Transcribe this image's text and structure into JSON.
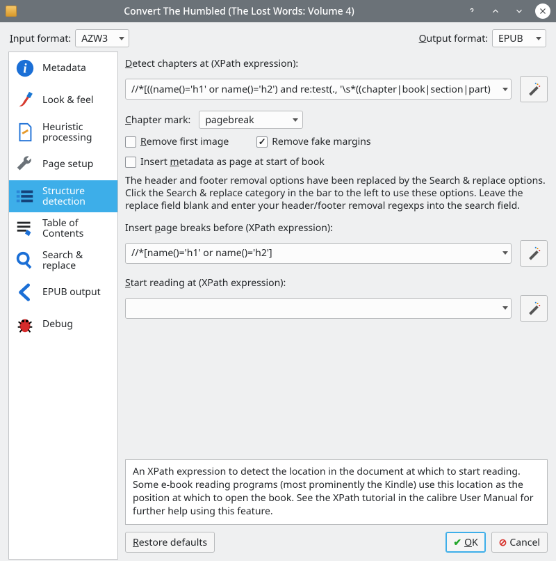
{
  "window": {
    "title": "Convert The Humbled (The Lost Words: Volume 4)"
  },
  "format": {
    "input_label_pre": "I",
    "input_label_rest": "nput format:",
    "input_value": "AZW3",
    "output_label_pre": "O",
    "output_label_rest": "utput format:",
    "output_value": "EPUB"
  },
  "sidebar": {
    "items": [
      {
        "id": "metadata",
        "label": "Metadata"
      },
      {
        "id": "look",
        "label": "Look & feel"
      },
      {
        "id": "heuristic",
        "label": "Heuristic processing"
      },
      {
        "id": "pagesetup",
        "label": "Page setup"
      },
      {
        "id": "structure",
        "label": "Structure detection"
      },
      {
        "id": "toc",
        "label": "Table of Contents"
      },
      {
        "id": "search",
        "label": "Search & replace"
      },
      {
        "id": "epub",
        "label": "EPUB output"
      },
      {
        "id": "debug",
        "label": "Debug"
      }
    ],
    "selected": "structure"
  },
  "detect": {
    "label_pre": "D",
    "label_rest": "etect chapters at (XPath expression):",
    "value": "//*[((name()='h1' or name()='h2') and re:test(., '\\s*((chapter|book|section|part)"
  },
  "chapter_mark": {
    "label_pre": "C",
    "label_rest": "hapter mark:",
    "value": "pagebreak"
  },
  "checks": {
    "remove_first_pre": "R",
    "remove_first_rest": "emove first image",
    "remove_first_checked": false,
    "remove_fake": "Remove fake margins",
    "remove_fake_checked": true,
    "insert_meta_pre": "m",
    "insert_meta_before": "Insert ",
    "insert_meta_after": "etadata as page at start of book",
    "insert_meta_checked": false
  },
  "paragraph": "The header and footer removal options have been replaced by the Search & replace options. Click the Search & replace category in the bar to the left to use these options. Leave the replace field blank and enter your header/footer removal regexps into the search field.",
  "page_breaks": {
    "label_pre": "p",
    "label_before": "Insert ",
    "label_after": "age breaks before (XPath expression):",
    "value": "//*[name()='h1' or name()='h2']"
  },
  "start_reading": {
    "label_pre": "S",
    "label_rest": "tart reading at (XPath expression):",
    "value": ""
  },
  "helpbox": "An XPath expression to detect the location in the document at which to start reading. Some e-book reading programs (most prominently the Kindle) use this location as the position at which to open the book. See the XPath tutorial in the calibre User Manual for further help using this feature.",
  "buttons": {
    "restore_pre": "R",
    "restore_rest": "estore defaults",
    "ok_pre": "O",
    "ok_rest": "K",
    "cancel": "Cancel"
  }
}
